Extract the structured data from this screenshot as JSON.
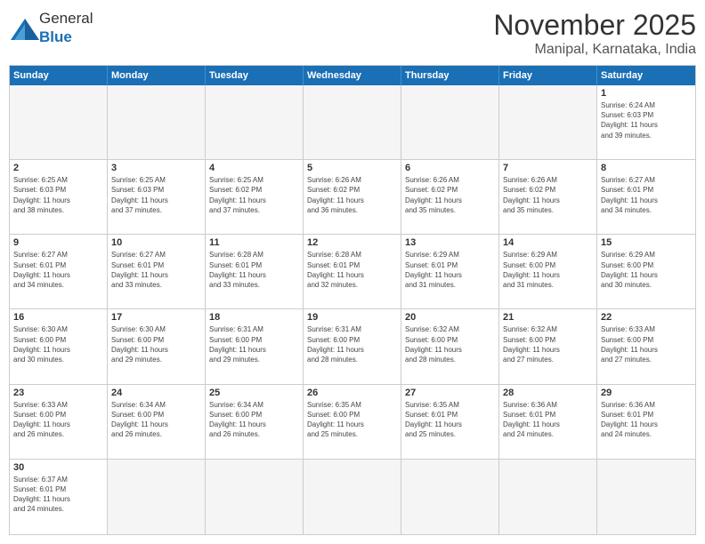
{
  "header": {
    "logo": {
      "general": "General",
      "blue": "Blue"
    },
    "title": "November 2025",
    "location": "Manipal, Karnataka, India"
  },
  "days": [
    "Sunday",
    "Monday",
    "Tuesday",
    "Wednesday",
    "Thursday",
    "Friday",
    "Saturday"
  ],
  "cells": [
    {
      "day": "",
      "empty": true,
      "info": ""
    },
    {
      "day": "",
      "empty": true,
      "info": ""
    },
    {
      "day": "",
      "empty": true,
      "info": ""
    },
    {
      "day": "",
      "empty": true,
      "info": ""
    },
    {
      "day": "",
      "empty": true,
      "info": ""
    },
    {
      "day": "",
      "empty": true,
      "info": ""
    },
    {
      "day": "1",
      "info": "Sunrise: 6:24 AM\nSunset: 6:03 PM\nDaylight: 11 hours\nand 39 minutes."
    },
    {
      "day": "2",
      "info": "Sunrise: 6:25 AM\nSunset: 6:03 PM\nDaylight: 11 hours\nand 38 minutes."
    },
    {
      "day": "3",
      "info": "Sunrise: 6:25 AM\nSunset: 6:03 PM\nDaylight: 11 hours\nand 37 minutes."
    },
    {
      "day": "4",
      "info": "Sunrise: 6:25 AM\nSunset: 6:02 PM\nDaylight: 11 hours\nand 37 minutes."
    },
    {
      "day": "5",
      "info": "Sunrise: 6:26 AM\nSunset: 6:02 PM\nDaylight: 11 hours\nand 36 minutes."
    },
    {
      "day": "6",
      "info": "Sunrise: 6:26 AM\nSunset: 6:02 PM\nDaylight: 11 hours\nand 35 minutes."
    },
    {
      "day": "7",
      "info": "Sunrise: 6:26 AM\nSunset: 6:02 PM\nDaylight: 11 hours\nand 35 minutes."
    },
    {
      "day": "8",
      "info": "Sunrise: 6:27 AM\nSunset: 6:01 PM\nDaylight: 11 hours\nand 34 minutes."
    },
    {
      "day": "9",
      "info": "Sunrise: 6:27 AM\nSunset: 6:01 PM\nDaylight: 11 hours\nand 34 minutes."
    },
    {
      "day": "10",
      "info": "Sunrise: 6:27 AM\nSunset: 6:01 PM\nDaylight: 11 hours\nand 33 minutes."
    },
    {
      "day": "11",
      "info": "Sunrise: 6:28 AM\nSunset: 6:01 PM\nDaylight: 11 hours\nand 33 minutes."
    },
    {
      "day": "12",
      "info": "Sunrise: 6:28 AM\nSunset: 6:01 PM\nDaylight: 11 hours\nand 32 minutes."
    },
    {
      "day": "13",
      "info": "Sunrise: 6:29 AM\nSunset: 6:01 PM\nDaylight: 11 hours\nand 31 minutes."
    },
    {
      "day": "14",
      "info": "Sunrise: 6:29 AM\nSunset: 6:00 PM\nDaylight: 11 hours\nand 31 minutes."
    },
    {
      "day": "15",
      "info": "Sunrise: 6:29 AM\nSunset: 6:00 PM\nDaylight: 11 hours\nand 30 minutes."
    },
    {
      "day": "16",
      "info": "Sunrise: 6:30 AM\nSunset: 6:00 PM\nDaylight: 11 hours\nand 30 minutes."
    },
    {
      "day": "17",
      "info": "Sunrise: 6:30 AM\nSunset: 6:00 PM\nDaylight: 11 hours\nand 29 minutes."
    },
    {
      "day": "18",
      "info": "Sunrise: 6:31 AM\nSunset: 6:00 PM\nDaylight: 11 hours\nand 29 minutes."
    },
    {
      "day": "19",
      "info": "Sunrise: 6:31 AM\nSunset: 6:00 PM\nDaylight: 11 hours\nand 28 minutes."
    },
    {
      "day": "20",
      "info": "Sunrise: 6:32 AM\nSunset: 6:00 PM\nDaylight: 11 hours\nand 28 minutes."
    },
    {
      "day": "21",
      "info": "Sunrise: 6:32 AM\nSunset: 6:00 PM\nDaylight: 11 hours\nand 27 minutes."
    },
    {
      "day": "22",
      "info": "Sunrise: 6:33 AM\nSunset: 6:00 PM\nDaylight: 11 hours\nand 27 minutes."
    },
    {
      "day": "23",
      "info": "Sunrise: 6:33 AM\nSunset: 6:00 PM\nDaylight: 11 hours\nand 26 minutes."
    },
    {
      "day": "24",
      "info": "Sunrise: 6:34 AM\nSunset: 6:00 PM\nDaylight: 11 hours\nand 26 minutes."
    },
    {
      "day": "25",
      "info": "Sunrise: 6:34 AM\nSunset: 6:00 PM\nDaylight: 11 hours\nand 26 minutes."
    },
    {
      "day": "26",
      "info": "Sunrise: 6:35 AM\nSunset: 6:00 PM\nDaylight: 11 hours\nand 25 minutes."
    },
    {
      "day": "27",
      "info": "Sunrise: 6:35 AM\nSunset: 6:01 PM\nDaylight: 11 hours\nand 25 minutes."
    },
    {
      "day": "28",
      "info": "Sunrise: 6:36 AM\nSunset: 6:01 PM\nDaylight: 11 hours\nand 24 minutes."
    },
    {
      "day": "29",
      "info": "Sunrise: 6:36 AM\nSunset: 6:01 PM\nDaylight: 11 hours\nand 24 minutes."
    },
    {
      "day": "30",
      "info": "Sunrise: 6:37 AM\nSunset: 6:01 PM\nDaylight: 11 hours\nand 24 minutes."
    },
    {
      "day": "",
      "empty": true,
      "info": ""
    },
    {
      "day": "",
      "empty": true,
      "info": ""
    },
    {
      "day": "",
      "empty": true,
      "info": ""
    },
    {
      "day": "",
      "empty": true,
      "info": ""
    },
    {
      "day": "",
      "empty": true,
      "info": ""
    },
    {
      "day": "",
      "empty": true,
      "info": ""
    }
  ]
}
